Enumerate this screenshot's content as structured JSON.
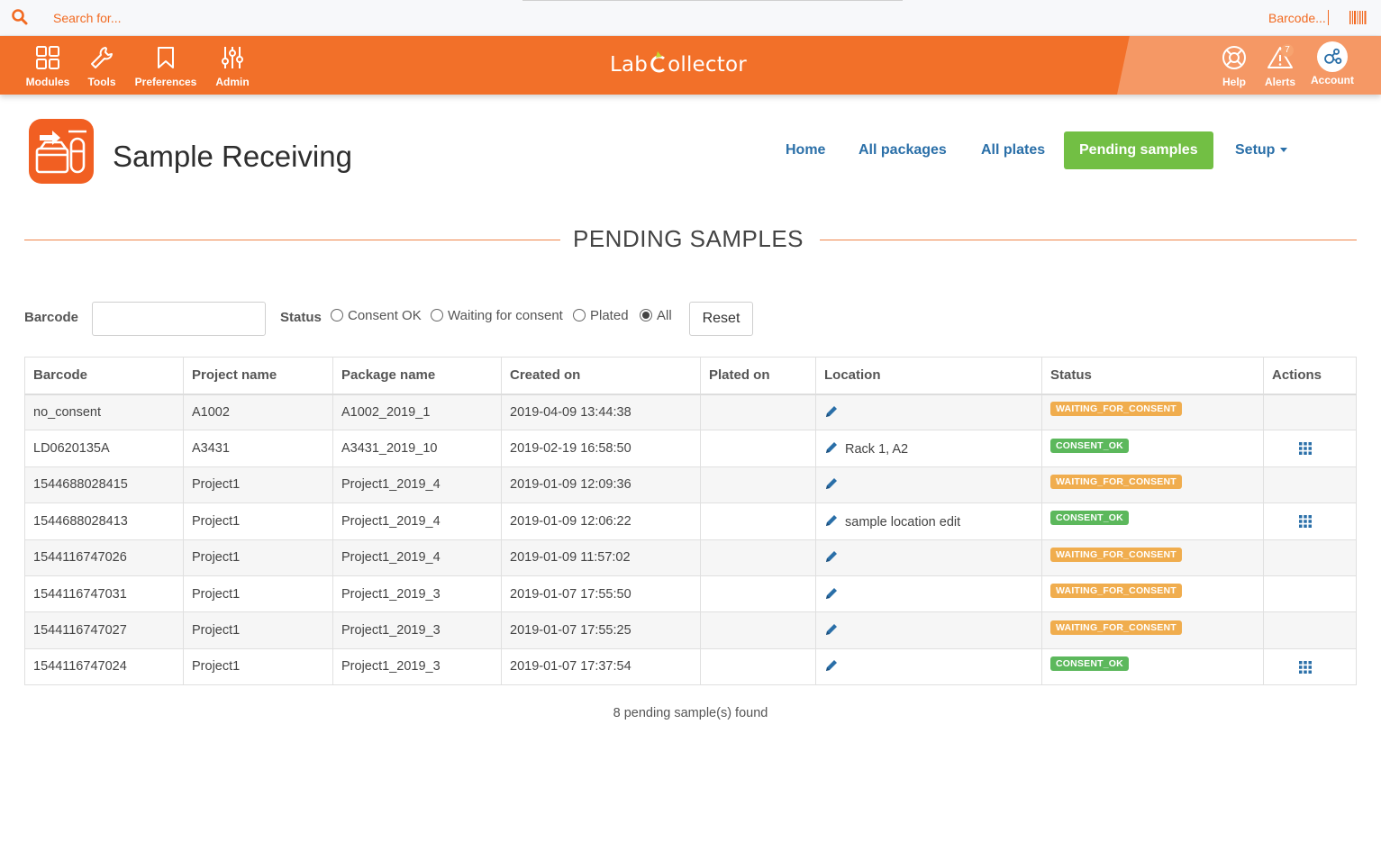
{
  "topbar": {
    "search_placeholder": "Search for...",
    "barcode_placeholder": "Barcode..."
  },
  "nav": {
    "left": [
      {
        "label": "Modules",
        "icon": "modules-icon"
      },
      {
        "label": "Tools",
        "icon": "wrench-icon"
      },
      {
        "label": "Preferences",
        "icon": "bookmark-icon"
      },
      {
        "label": "Admin",
        "icon": "sliders-icon"
      }
    ],
    "right": [
      {
        "label": "Help",
        "icon": "lifebuoy-icon"
      },
      {
        "label": "Alerts",
        "icon": "warning-icon",
        "count": "7"
      },
      {
        "label": "Account",
        "icon": "account-icon"
      }
    ],
    "logo_left": "Lab",
    "logo_right": "ollector"
  },
  "header": {
    "title": "Sample Receiving",
    "links": [
      {
        "label": "Home"
      },
      {
        "label": "All packages"
      },
      {
        "label": "All plates"
      },
      {
        "label": "Pending samples",
        "active": true
      },
      {
        "label": "Setup"
      }
    ]
  },
  "section_title": "PENDING SAMPLES",
  "filters": {
    "barcode_label": "Barcode",
    "barcode_value": "",
    "status_label": "Status",
    "options": [
      "Consent OK",
      "Waiting for consent",
      "Plated",
      "All"
    ],
    "selected": "All",
    "reset_label": "Reset"
  },
  "table": {
    "columns": [
      "Barcode",
      "Project name",
      "Package name",
      "Created on",
      "Plated on",
      "Location",
      "Status",
      "Actions"
    ],
    "rows": [
      {
        "barcode": "no_consent",
        "project": "A1002",
        "package": "A1002_2019_1",
        "created": "2019-04-09 13:44:38",
        "plated": "",
        "location": "",
        "status": "WAITING_FOR_CONSENT",
        "action": false
      },
      {
        "barcode": "LD0620135A",
        "project": "A3431",
        "package": "A3431_2019_10",
        "created": "2019-02-19 16:58:50",
        "plated": "",
        "location": "Rack 1, A2",
        "status": "CONSENT_OK",
        "action": true
      },
      {
        "barcode": "1544688028415",
        "project": "Project1",
        "package": "Project1_2019_4",
        "created": "2019-01-09 12:09:36",
        "plated": "",
        "location": "",
        "status": "WAITING_FOR_CONSENT",
        "action": false
      },
      {
        "barcode": "1544688028413",
        "project": "Project1",
        "package": "Project1_2019_4",
        "created": "2019-01-09 12:06:22",
        "plated": "",
        "location": "sample location edit",
        "status": "CONSENT_OK",
        "action": true
      },
      {
        "barcode": "1544116747026",
        "project": "Project1",
        "package": "Project1_2019_4",
        "created": "2019-01-09 11:57:02",
        "plated": "",
        "location": "",
        "status": "WAITING_FOR_CONSENT",
        "action": false
      },
      {
        "barcode": "1544116747031",
        "project": "Project1",
        "package": "Project1_2019_3",
        "created": "2019-01-07 17:55:50",
        "plated": "",
        "location": "",
        "status": "WAITING_FOR_CONSENT",
        "action": false
      },
      {
        "barcode": "1544116747027",
        "project": "Project1",
        "package": "Project1_2019_3",
        "created": "2019-01-07 17:55:25",
        "plated": "",
        "location": "",
        "status": "WAITING_FOR_CONSENT",
        "action": false
      },
      {
        "barcode": "1544116747024",
        "project": "Project1",
        "package": "Project1_2019_3",
        "created": "2019-01-07 17:37:54",
        "plated": "",
        "location": "",
        "status": "CONSENT_OK",
        "action": true
      }
    ]
  },
  "footer": {
    "count_text": "8 pending sample(s) found"
  },
  "colors": {
    "brand_orange": "#f27029",
    "active_green": "#72bf44",
    "link_blue": "#2a6fa8",
    "waiting": "#f0ad4e",
    "consent_ok": "#5cb85c"
  }
}
